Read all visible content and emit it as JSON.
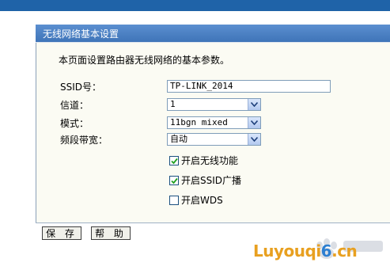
{
  "panel": {
    "title": "无线网络基本设置",
    "description": "本页面设置路由器无线网络的基本参数。"
  },
  "form": {
    "ssid_label": "SSID号：",
    "ssid_value": "TP-LINK_2014",
    "channel_label": "信道：",
    "channel_value": "1",
    "mode_label": "模式：",
    "mode_value": "11bgn mixed",
    "bandwidth_label": "频段带宽：",
    "bandwidth_value": "自动",
    "enable_wireless_label": "开启无线功能",
    "enable_wireless_checked": true,
    "ssid_broadcast_label": "开启SSID广播",
    "ssid_broadcast_checked": true,
    "wds_label": "开启WDS",
    "wds_checked": false
  },
  "buttons": {
    "save": "保 存",
    "help": "帮 助"
  },
  "watermark": {
    "site_part1": "Luyouqi",
    "site_part2": "6",
    "site_part3": ".cn"
  },
  "colors": {
    "header_blue": "#3f74b8",
    "top_band": "#1f63a8",
    "panel_bg": "#fbfbf3",
    "watermark_orange": "#e8a020",
    "watermark_blue": "#2d7fd1"
  },
  "icons": {
    "dropdown": "chevron-down-icon",
    "check": "checkmark-icon",
    "watermark": "baidu-paw-icon"
  }
}
